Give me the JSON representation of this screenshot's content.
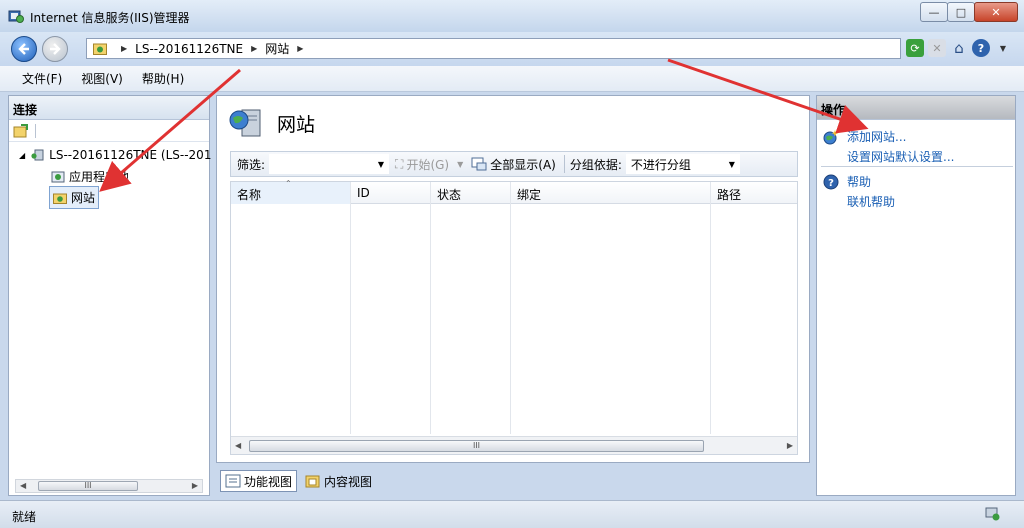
{
  "window": {
    "title": "Internet 信息服务(IIS)管理器",
    "min_glyph": "—",
    "max_glyph": "□",
    "close_glyph": "✕"
  },
  "address": {
    "crumbs": [
      "LS--20161126TNE",
      "网站"
    ],
    "sep": "▶"
  },
  "menu": {
    "items": [
      "文件(F)",
      "视图(V)",
      "帮助(H)"
    ]
  },
  "connections": {
    "title": "连接",
    "tree": {
      "server": "LS--20161126TNE (LS--201",
      "app_pools": "应用程序池",
      "sites": "网站"
    },
    "scroll_glyph": "III"
  },
  "main": {
    "title": "网站",
    "filter_label": "筛选:",
    "start_label": "开始(G)",
    "show_all_label": "全部显示(A)",
    "group_label": "分组依据:",
    "group_value": "不进行分组",
    "columns": [
      "名称",
      "ID",
      "状态",
      "绑定",
      "路径"
    ],
    "scroll_glyph": "III"
  },
  "view_tabs": {
    "feature_view": "功能视图",
    "content_view": "内容视图"
  },
  "actions": {
    "title": "操作",
    "add_site": "添加网站...",
    "site_defaults": "设置网站默认设置...",
    "help": "帮助",
    "online_help": "联机帮助"
  },
  "status": {
    "text": "就绪"
  },
  "colors": {
    "accent_link": "#1a5fb4",
    "arrow": "#e03232"
  }
}
